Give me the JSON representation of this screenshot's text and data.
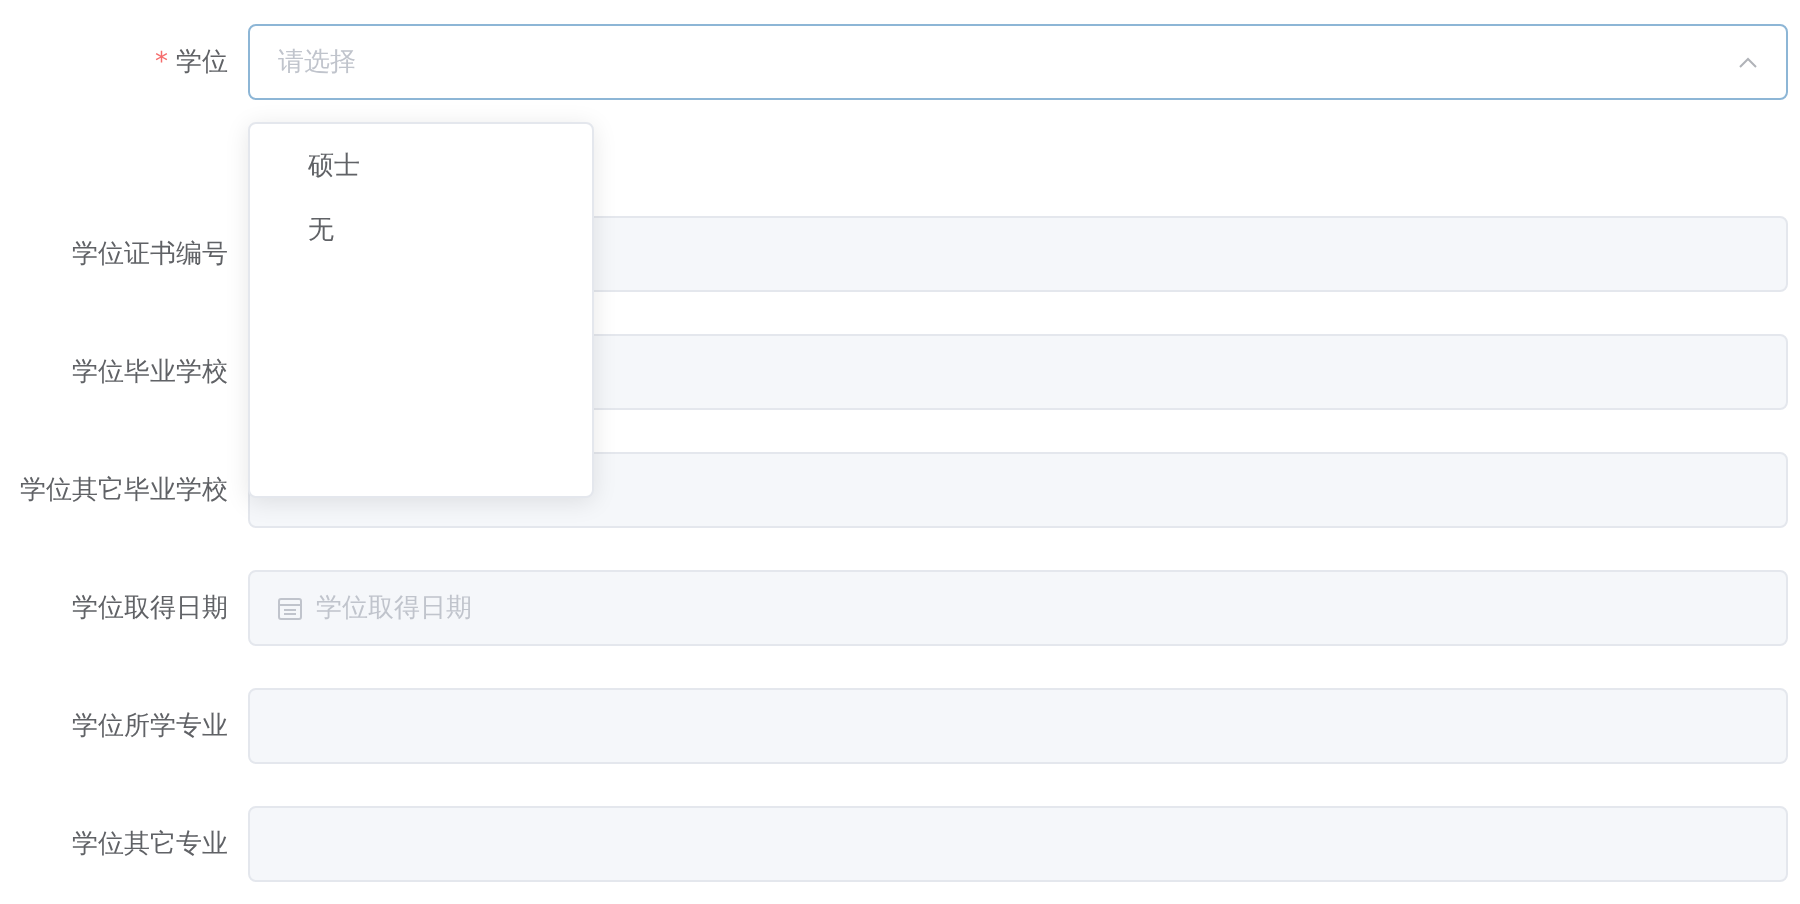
{
  "fields": [
    {
      "kind": "select",
      "label": "学位",
      "required_mark": "*",
      "placeholder": "请选择",
      "expanded": true,
      "options": [
        {
          "label": "硕士",
          "selected": false
        },
        {
          "label": "无",
          "selected": false
        }
      ]
    },
    {
      "kind": "text",
      "label": "学位证书编号"
    },
    {
      "kind": "text",
      "label": "学位毕业学校"
    },
    {
      "kind": "text",
      "label": "学位其它毕业学校"
    },
    {
      "kind": "date",
      "label": "学位取得日期",
      "placeholder": "学位取得日期"
    },
    {
      "kind": "text",
      "label": "学位所学专业"
    },
    {
      "kind": "text",
      "label": "学位其它专业"
    }
  ]
}
